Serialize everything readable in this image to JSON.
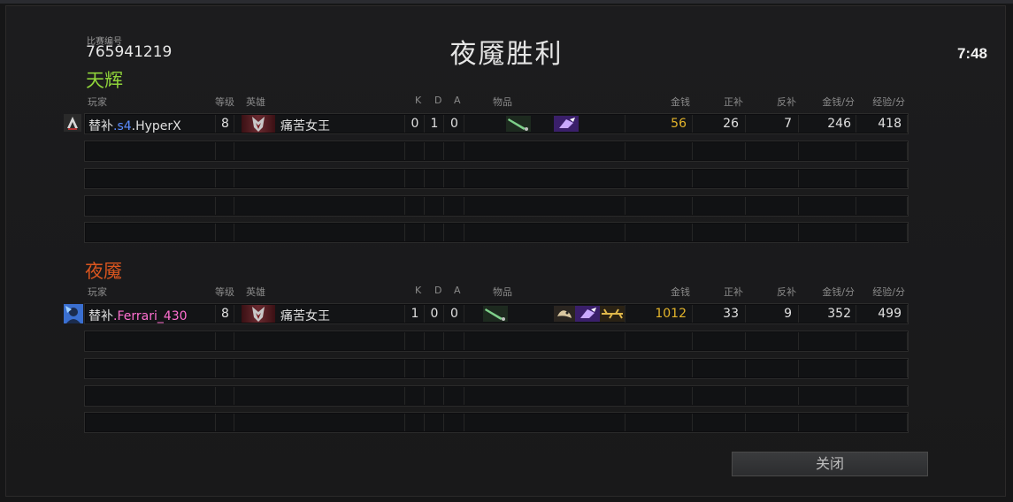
{
  "match": {
    "id_label": "比赛编号",
    "id": "765941219"
  },
  "result_title": "夜魇胜利",
  "game_time": "7:48",
  "headers": {
    "player": "玩家",
    "level": "等级",
    "hero": "英雄",
    "k": "K",
    "d": "D",
    "a": "A",
    "items": "物品",
    "gold": "金钱",
    "last_hits": "正补",
    "denies": "反补",
    "gpm": "金钱/分",
    "xpm": "经验/分"
  },
  "radiant": {
    "name": "天辉",
    "players": [
      {
        "name_prefix": "替补",
        "name_tag": ".s4",
        "name_main": ".HyperX",
        "level": "8",
        "hero": "痛苦女王",
        "kills": "0",
        "deaths": "1",
        "assists": "0",
        "items": [
          "sword-item-icon",
          "purple-glove-item-icon"
        ],
        "gold": "56",
        "last_hits": "26",
        "denies": "7",
        "gpm": "246",
        "xpm": "418"
      }
    ]
  },
  "dire": {
    "name": "夜魇",
    "players": [
      {
        "name_prefix": "替补",
        "name_tag": "",
        "name_main": ".Ferrari_430",
        "level": "8",
        "hero": "痛苦女王",
        "kills": "1",
        "deaths": "0",
        "assists": "0",
        "items": [
          "sword-item-icon",
          "bird-item-icon",
          "purple-glove-item-icon",
          "golden-branch-item-icon"
        ],
        "gold": "1012",
        "last_hits": "33",
        "denies": "9",
        "gpm": "352",
        "xpm": "499"
      }
    ]
  },
  "colors": {
    "radiant": "#8fd33a",
    "dire": "#d9551f",
    "gold": "#e3b42b",
    "radiant_tag": "#5a8cff",
    "dire_player": "#ff6fd0"
  },
  "close_button": "关闭"
}
